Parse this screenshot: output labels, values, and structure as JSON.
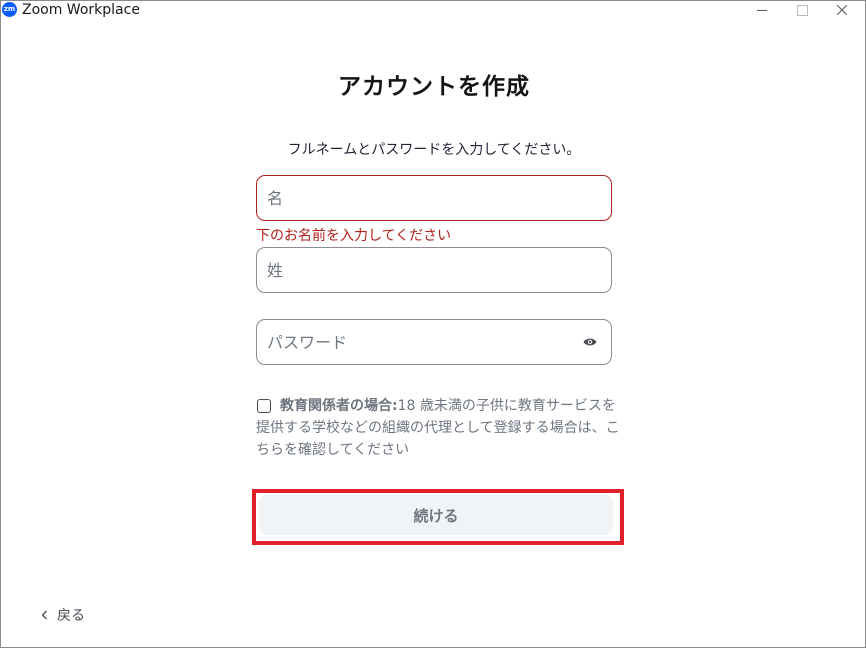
{
  "window": {
    "title": "Zoom Workplace",
    "icon_label": "zm"
  },
  "page": {
    "title": "アカウントを作成",
    "subtitle": "フルネームとパスワードを入力してください。"
  },
  "form": {
    "first_name_placeholder": "名",
    "first_name_value": "",
    "first_name_error": "下のお名前を入力してください",
    "last_name_placeholder": "姓",
    "last_name_value": "",
    "password_placeholder": "パスワード",
    "password_value": ""
  },
  "education": {
    "checked": false,
    "bold_label": "教育関係者の場合:",
    "text": "18 歳未満の子供に教育サービスを提供する学校などの組織の代理として登録する場合は、こちらを確認してください"
  },
  "actions": {
    "continue_label": "続ける",
    "back_label": "戻る"
  },
  "colors": {
    "error": "#b0211c",
    "highlight": "#e0212c",
    "brand": "#0b5cff",
    "button_bg": "#f1f4f6"
  }
}
